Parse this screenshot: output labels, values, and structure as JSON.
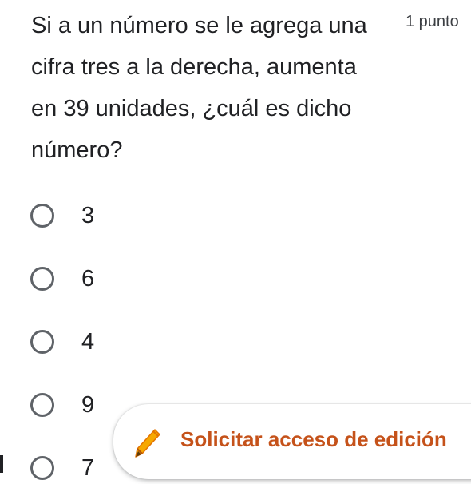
{
  "question": {
    "text": "Si a un número se le agrega una\ncifra tres a la derecha, aumenta\nen 39 unidades, ¿cuál es dicho\nnúmero?",
    "points": "1 punto"
  },
  "options": [
    "3",
    "6",
    "4",
    "9",
    "7"
  ],
  "edit_access": {
    "label": "Solicitar acceso de edición",
    "icon": "pencil-icon"
  },
  "colors": {
    "accent": "#c5521a",
    "radio_border": "#5f6368",
    "text": "#202124"
  }
}
